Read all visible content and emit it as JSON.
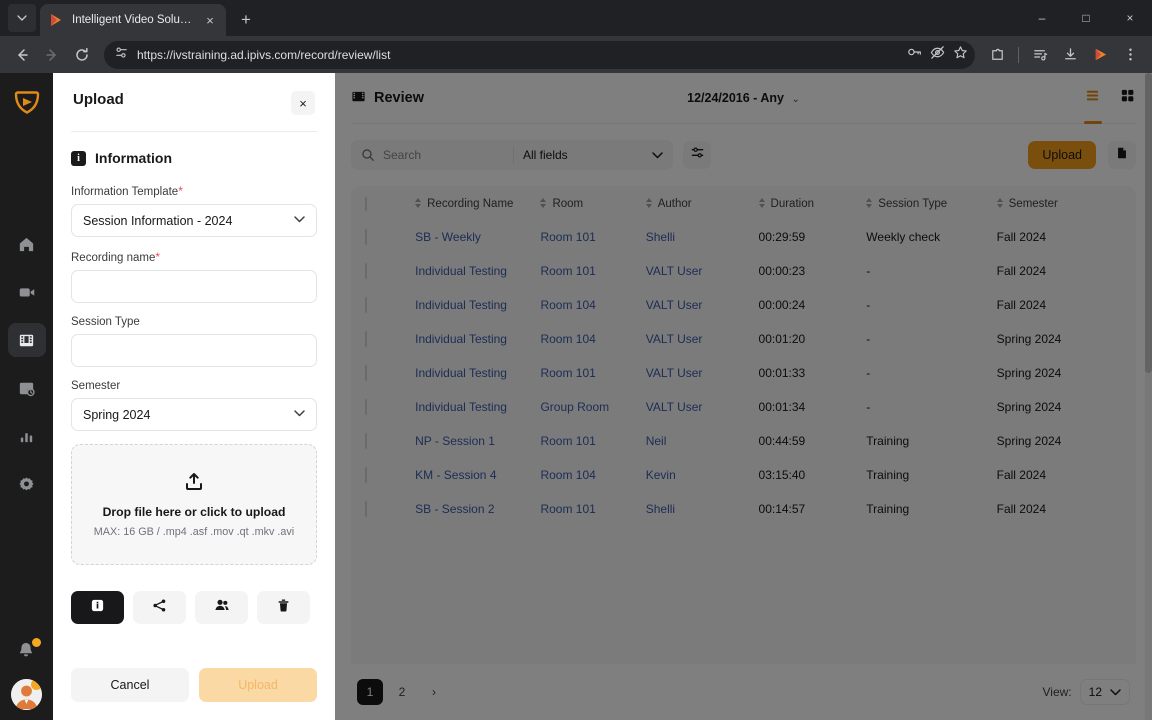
{
  "browser": {
    "tab": {
      "title": "Intelligent Video Solutions",
      "favicon": "ivs-play-icon",
      "close": "×"
    },
    "new_tab": "+",
    "window_controls": {
      "minimize": "–",
      "maximize": "□",
      "close": "×"
    },
    "nav": {
      "back": "←",
      "forward": "→",
      "reload": "↻"
    },
    "address": {
      "url": "https://ivstraining.ad.ipivs.com/record/review/list",
      "site_info_icon": "tune-icon"
    },
    "omnibox_icons": [
      "key-icon",
      "eye-off-icon",
      "star-icon"
    ],
    "toolbar_icons": [
      "extensions-icon",
      "reading-list-icon",
      "downloads-icon",
      "ivs-extension-icon",
      "more-menu-icon"
    ]
  },
  "rail": {
    "logo": "ivs-shield-logo",
    "items": [
      {
        "name": "home-icon",
        "active": false
      },
      {
        "name": "video-camera-icon",
        "active": false
      },
      {
        "name": "film-strip-icon",
        "active": true
      },
      {
        "name": "schedule-icon",
        "active": false
      },
      {
        "name": "bar-chart-icon",
        "active": false
      },
      {
        "name": "gear-icon",
        "active": false
      }
    ],
    "bottom": [
      {
        "name": "bell-icon",
        "badge": true
      },
      {
        "name": "avatar",
        "badge": true
      }
    ]
  },
  "panel": {
    "title": "Upload",
    "close_label": "×",
    "section": {
      "icon": "info-icon",
      "title": "Information"
    },
    "fields": [
      {
        "label": "Information Template",
        "required": true,
        "type": "select",
        "value": "Session Information - 2024"
      },
      {
        "label": "Recording name",
        "required": true,
        "type": "text",
        "value": ""
      },
      {
        "label": "Session Type",
        "required": false,
        "type": "text",
        "value": ""
      },
      {
        "label": "Semester",
        "required": false,
        "type": "select",
        "value": "Spring 2024"
      }
    ],
    "required_mark": "*",
    "dropzone": {
      "icon": "upload-icon",
      "title": "Drop file here or click to upload",
      "subtitle": "MAX: 16 GB / .mp4 .asf .mov .qt .mkv .avi"
    },
    "tools": [
      {
        "name": "info-tab-button",
        "icon": "info-icon",
        "active": true
      },
      {
        "name": "share-tab-button",
        "icon": "share-icon",
        "active": false
      },
      {
        "name": "people-tab-button",
        "icon": "people-icon",
        "active": false
      },
      {
        "name": "delete-tab-button",
        "icon": "trash-icon",
        "active": false
      }
    ],
    "cancel_label": "Cancel",
    "upload_label": "Upload"
  },
  "main": {
    "header": {
      "icon": "film-strip-icon",
      "title": "Review",
      "date_filter": "12/24/2016 - Any",
      "chevron": "⌄",
      "list_view_icon": "list-view-icon",
      "grid_view_icon": "grid-view-icon"
    },
    "search": {
      "placeholder": "Search",
      "icon": "search-icon",
      "fields_value": "All fields",
      "chevron": "⌄",
      "filter_icon": "filter-sliders-icon"
    },
    "actions": {
      "upload_label": "Upload",
      "document_icon": "document-icon"
    },
    "table": {
      "columns": [
        "Recording Name",
        "Room",
        "Author",
        "Duration",
        "Session Type",
        "Semester"
      ],
      "rows": [
        {
          "name": "SB - Weekly",
          "room": "Room 101",
          "author": "Shelli",
          "duration": "00:29:59",
          "session_type": "Weekly check",
          "semester": "Fall 2024"
        },
        {
          "name": "Individual Testing",
          "room": "Room 101",
          "author": "VALT User",
          "duration": "00:00:23",
          "session_type": "-",
          "semester": "Fall 2024"
        },
        {
          "name": "Individual Testing",
          "room": "Room 104",
          "author": "VALT User",
          "duration": "00:00:24",
          "session_type": "-",
          "semester": "Fall 2024"
        },
        {
          "name": "Individual Testing",
          "room": "Room 104",
          "author": "VALT User",
          "duration": "00:01:20",
          "session_type": "-",
          "semester": "Spring 2024"
        },
        {
          "name": "Individual Testing",
          "room": "Room 101",
          "author": "VALT User",
          "duration": "00:01:33",
          "session_type": "-",
          "semester": "Spring 2024"
        },
        {
          "name": "Individual Testing",
          "room": "Group Room",
          "author": "VALT User",
          "duration": "00:01:34",
          "session_type": "-",
          "semester": "Spring 2024"
        },
        {
          "name": "NP - Session 1",
          "room": "Room 101",
          "author": "Neil",
          "duration": "00:44:59",
          "session_type": "Training",
          "semester": "Spring 2024"
        },
        {
          "name": "KM - Session 4",
          "room": "Room 104",
          "author": "Kevin",
          "duration": "03:15:40",
          "session_type": "Training",
          "semester": "Fall 2024"
        },
        {
          "name": "SB - Session 2",
          "room": "Room 101",
          "author": "Shelli",
          "duration": "00:14:57",
          "session_type": "Training",
          "semester": "Fall 2024"
        }
      ]
    },
    "pagination": {
      "pages": [
        "1",
        "2"
      ],
      "active_page": "1",
      "next_label": "›",
      "view_label": "View:",
      "view_value": "12",
      "view_chevron": "⌄"
    }
  },
  "colors": {
    "accent_orange": "#f59e1b",
    "accent_underline": "#e08a17",
    "link_blue": "#3a5ba8",
    "required_red": "#f04a5e",
    "dark": "#18181b",
    "upload_disabled": "#fbd9a5"
  }
}
